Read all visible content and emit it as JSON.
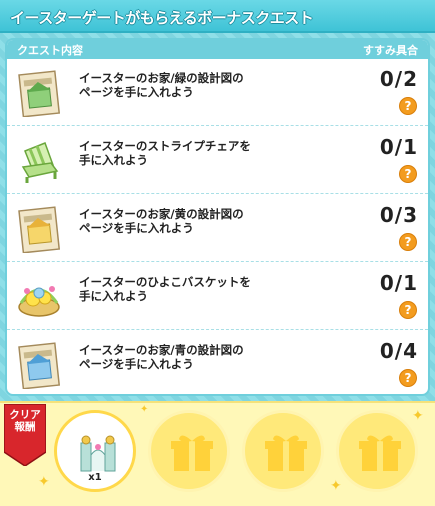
{
  "window": {
    "title": "イースターゲートがもらえるボーナスクエスト"
  },
  "table": {
    "col_content": "クエスト内容",
    "col_progress": "すすみ具合"
  },
  "quests": [
    {
      "line1": "イースターのお家/緑の設計図の",
      "line2": "ページを手に入れよう",
      "progress": "0/2",
      "help": "?",
      "icon": "blueprint-green-icon"
    },
    {
      "line1": "イースターのストライプチェアを",
      "line2": "手に入れよう",
      "progress": "0/1",
      "help": "?",
      "icon": "striped-chair-icon"
    },
    {
      "line1": "イースターのお家/黄の設計図の",
      "line2": "ページを手に入れよう",
      "progress": "0/3",
      "help": "?",
      "icon": "blueprint-yellow-icon"
    },
    {
      "line1": "イースターのひよこバスケットを",
      "line2": "手に入れよう",
      "progress": "0/1",
      "help": "?",
      "icon": "chick-basket-icon"
    },
    {
      "line1": "イースターのお家/青の設計図の",
      "line2": "ページを手に入れよう",
      "progress": "0/4",
      "help": "?",
      "icon": "blueprint-blue-icon"
    }
  ],
  "reward": {
    "ribbon_line1": "クリア",
    "ribbon_line2": "報酬",
    "item_qty": "x1",
    "item_icon": "easter-gate-icon",
    "locked_icon": "gift-box-icon"
  },
  "colors": {
    "title_bar": "#3fc3d6",
    "panel_header": "#6fcfdc",
    "help_badge": "#f39c1f",
    "reward_bar": "#fff8b8",
    "ribbon": "#d8262c"
  }
}
